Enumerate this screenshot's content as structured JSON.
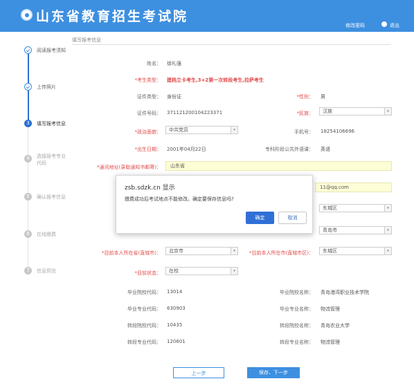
{
  "header": {
    "title": "山东省教育招生考试院",
    "change_pwd": "修改密码",
    "logout": "退出"
  },
  "steps": [
    {
      "label": "阅读报考须知",
      "state": "done",
      "num": ""
    },
    {
      "label": "上传照片",
      "state": "done",
      "num": ""
    },
    {
      "label": "填写报考信息",
      "state": "current",
      "num": "3"
    },
    {
      "label": "选报报考专业\n代码",
      "state": "todo",
      "num": "4"
    },
    {
      "label": "确认报考信息",
      "state": "todo",
      "num": "5"
    },
    {
      "label": "在线缴费",
      "state": "todo",
      "num": "6"
    },
    {
      "label": "信息预览",
      "state": "todo",
      "num": "7"
    }
  ],
  "section_title": "填写报考信息",
  "form": {
    "name_label": "姓名：",
    "name": "徐礼强",
    "type_label": "*考生类型：",
    "type": "建档立卡考生,3+2第一次转段考生,拉萨考生",
    "id_type_label": "证件类型：",
    "id_type": "身份证",
    "gender_label": "*性别：",
    "gender": "男",
    "id_no_label": "证件号码：",
    "id_no": "371121200104223371",
    "ethnic_label": "*民族：",
    "ethnic": "汉族",
    "politics_label": "*政治面貌：",
    "politics": "中共党员",
    "phone_label": "手机号：",
    "phone": "18254106696",
    "birth_label": "*出生日期：",
    "birth": "2001年04月22日",
    "lang_label": "专科阶段公共外语课：",
    "lang": "英语",
    "addr_label": "*通讯地址(录取通知书邮寄)：",
    "addr": "山东省",
    "email": "11@qq.com",
    "district1": "东城区",
    "city1": "青岛市",
    "prov_label": "*目前本人所在省(直辖市)：",
    "prov": "北京市",
    "city_label": "*目前本人所在市(直辖市区)：",
    "city": "东城区",
    "status_label": "*目前状态：",
    "status": "在校",
    "grad_code_label": "毕业院校代码：",
    "grad_code": "13014",
    "grad_name_label": "毕业院校名称：",
    "grad_name": "青岛港湾职业技术学院",
    "major_code_label": "毕业专业代码：",
    "major_code": "630903",
    "major_name_label": "毕业专业名称：",
    "major_name": "物流管理",
    "tr_code_label": "转段院校代码：",
    "tr_code": "10435",
    "tr_name_label": "转段院校名称：",
    "tr_name": "青岛农业大学",
    "trm_code_label": "转段专业代码：",
    "trm_code": "120601",
    "trm_name_label": "转段专业名称：",
    "trm_name": "物流管理"
  },
  "buttons": {
    "prev": "上一步",
    "next": "保存、下一步"
  },
  "dialog": {
    "title": "zsb.sdzk.cn 显示",
    "message": "缴费成功后考试地点不能修改。确定要保存信息吗?",
    "ok": "确定",
    "cancel": "取消"
  },
  "colors": {
    "brand": "#3d8fe0",
    "required": "#e24a4a",
    "input_bg": "#fdfdd6"
  }
}
